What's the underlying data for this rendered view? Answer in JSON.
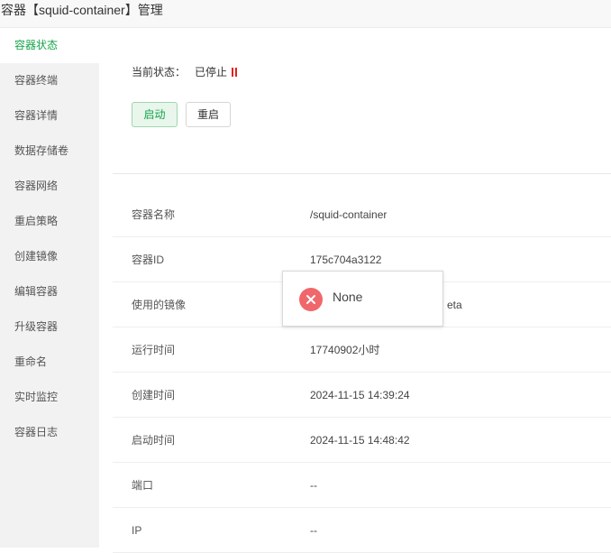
{
  "window": {
    "title": "容器【squid-container】管理"
  },
  "sidebar": {
    "items": [
      {
        "label": "容器状态",
        "active": true
      },
      {
        "label": "容器终端"
      },
      {
        "label": "容器详情"
      },
      {
        "label": "数据存储卷"
      },
      {
        "label": "容器网络"
      },
      {
        "label": "重启策略"
      },
      {
        "label": "创建镜像"
      },
      {
        "label": "编辑容器"
      },
      {
        "label": "升级容器"
      },
      {
        "label": "重命名"
      },
      {
        "label": "实时监控"
      },
      {
        "label": "容器日志"
      }
    ]
  },
  "status": {
    "label": "当前状态：",
    "value": "已停止"
  },
  "actions": {
    "start_label": "启动",
    "restart_label": "重启"
  },
  "details": [
    {
      "key": "容器名称",
      "value": "/squid-container"
    },
    {
      "key": "容器ID",
      "value": "175c704a3122"
    },
    {
      "key": "使用的镜像",
      "value": "eta"
    },
    {
      "key": "运行时间",
      "value": "17740902小时"
    },
    {
      "key": "创建时间",
      "value": "2024-11-15 14:39:24"
    },
    {
      "key": "启动时间",
      "value": "2024-11-15 14:48:42"
    },
    {
      "key": "端口",
      "value": "--"
    },
    {
      "key": "IP",
      "value": "--"
    }
  ],
  "toast": {
    "message": "None"
  },
  "colors": {
    "accent": "#16a34a",
    "stopped": "#e02020",
    "error": "#f0676b"
  }
}
